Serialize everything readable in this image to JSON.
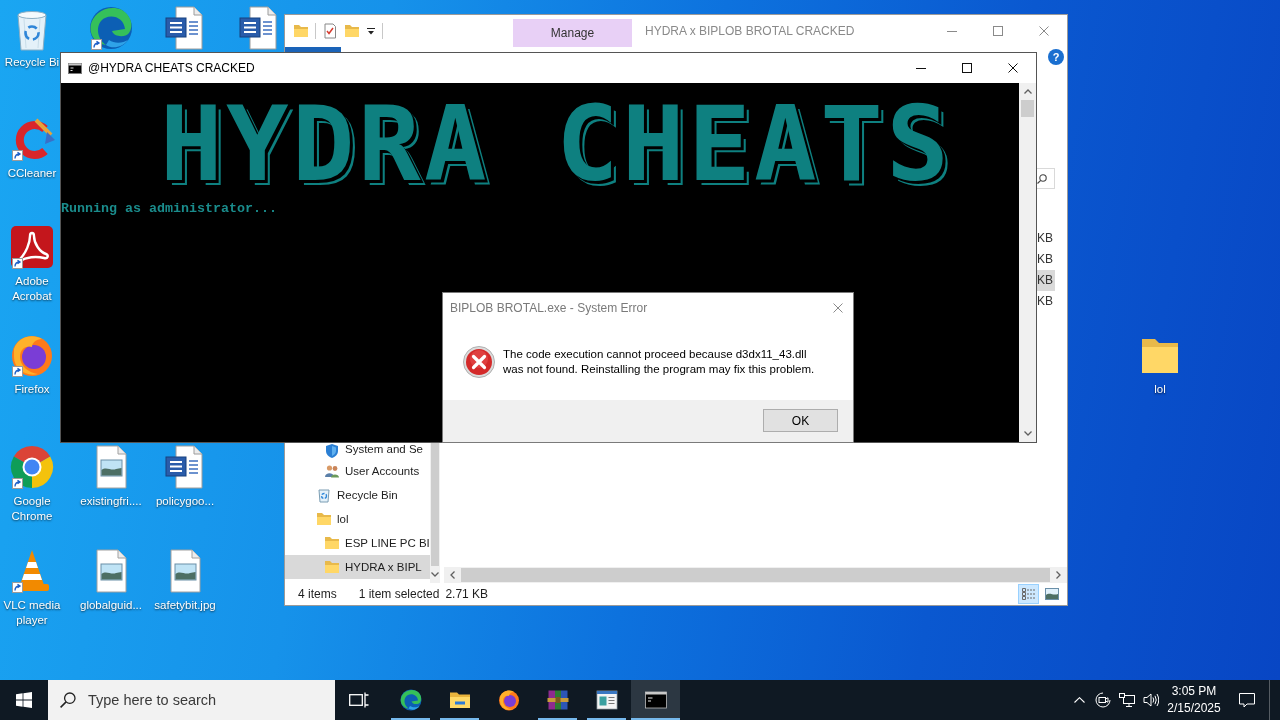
{
  "desktop": {
    "icons": [
      {
        "kind": "recycle-bin",
        "label": "Recycle Bi",
        "shortcut": false
      },
      {
        "kind": "edge",
        "shortcut": true
      },
      {
        "kind": "word-document",
        "shortcut": false
      },
      {
        "kind": "word-document",
        "shortcut": false
      },
      {
        "kind": "ccleaner",
        "label": "CCleaner",
        "shortcut": true
      },
      {
        "kind": "acrobat",
        "label": "Adobe Acrobat",
        "shortcut": true
      },
      {
        "kind": "firefox",
        "label": "Firefox",
        "shortcut": true
      },
      {
        "kind": "chrome",
        "label": "Google Chrome",
        "shortcut": true
      },
      {
        "kind": "image-file",
        "label": "existingfri....",
        "shortcut": false
      },
      {
        "kind": "word-document",
        "label": "policygoo...",
        "shortcut": false
      },
      {
        "kind": "vlc",
        "label": "VLC media player",
        "shortcut": true
      },
      {
        "kind": "image-file",
        "label": "globalguid...",
        "shortcut": false
      },
      {
        "kind": "image-file",
        "label": "safetybit.jpg",
        "shortcut": false
      },
      {
        "kind": "folder",
        "label": "lol",
        "shortcut": false
      }
    ]
  },
  "explorer": {
    "title": "HYDRA x BIPLOB BROTAL CRACKED",
    "context_tab": "Manage",
    "help": "?",
    "nav_tree": [
      {
        "children": [
          {
            "kind": "shield",
            "label": "System and Se",
            "selected": false
          },
          {
            "kind": "users",
            "label": "User Accounts",
            "selected": false
          }
        ]
      },
      {
        "kind": "recycle-bin",
        "label": "Recycle Bin",
        "selected": false
      },
      {
        "kind": "folder",
        "label": "lol",
        "selected": false,
        "children": [
          {
            "kind": "folder",
            "label": "ESP LINE PC BI",
            "selected": false
          },
          {
            "kind": "folder",
            "label": "HYDRA x BIPL",
            "selected": true
          }
        ]
      }
    ],
    "file_rows": [
      {
        "column_4": "KB",
        "selected": false
      },
      {
        "column_4": "KB",
        "selected": false
      },
      {
        "column_4": "KB",
        "selected": true
      },
      {
        "column_4": "KB",
        "selected": false
      }
    ],
    "status": {
      "item_count": "4 items",
      "selection": "1 item selected",
      "selection_size": "2.71 KB"
    },
    "views": [
      {
        "kind": "details",
        "selected": true
      },
      {
        "kind": "large-icons",
        "selected": false
      }
    ]
  },
  "console": {
    "title": "@HYDRA CHEATS CRACKED",
    "banner": "HYDRA CHEATS",
    "lines": [
      "Running as administrator..."
    ]
  },
  "dialog": {
    "title": "BIPLOB BROTAL.exe - System Error",
    "message": "The code execution cannot proceed because d3dx11_43.dll\nwas not found. Reinstalling the program may fix this problem.",
    "button": "OK"
  },
  "taskbar": {
    "search": {
      "placeholder": "Type here to search"
    },
    "apps": [
      {
        "kind": "edge",
        "running": true,
        "selected": false
      },
      {
        "kind": "file-explorer",
        "running": true,
        "selected": false
      },
      {
        "kind": "firefox",
        "running": false,
        "selected": false
      },
      {
        "kind": "winrar",
        "running": true,
        "selected": false
      },
      {
        "kind": "app-window",
        "running": true,
        "selected": false
      },
      {
        "kind": "terminal",
        "running": true,
        "selected": true
      }
    ],
    "clock": {
      "time": "3:05 PM",
      "date": "2/15/2025"
    }
  }
}
